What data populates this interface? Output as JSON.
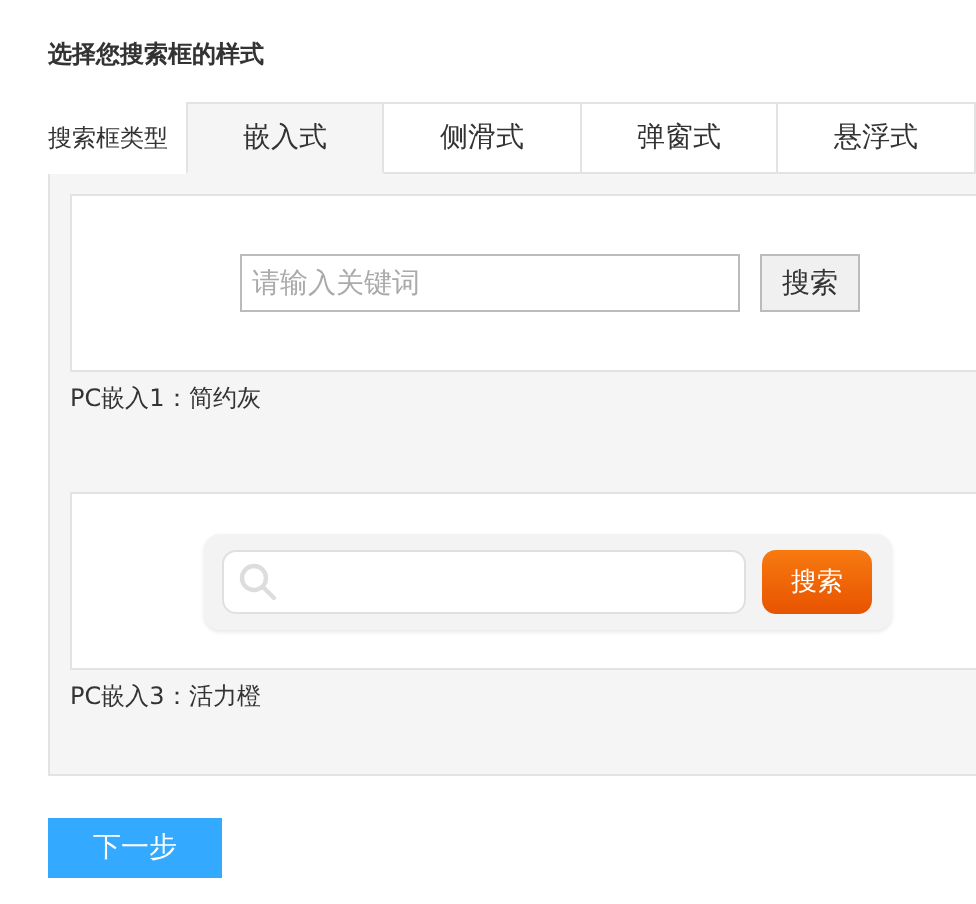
{
  "title": "选择您搜索框的样式",
  "type_label": "搜索框类型",
  "tabs": [
    {
      "label": "嵌入式",
      "selected": true
    },
    {
      "label": "侧滑式",
      "selected": false
    },
    {
      "label": "弹窗式",
      "selected": false
    },
    {
      "label": "悬浮式",
      "selected": false
    }
  ],
  "styles": [
    {
      "kind": "plain",
      "placeholder": "请输入关键词",
      "button": "搜索",
      "caption": "PC嵌入1：简约灰"
    },
    {
      "kind": "orange",
      "button": "搜索",
      "caption": "PC嵌入3：活力橙"
    }
  ],
  "next_button": "下一步"
}
